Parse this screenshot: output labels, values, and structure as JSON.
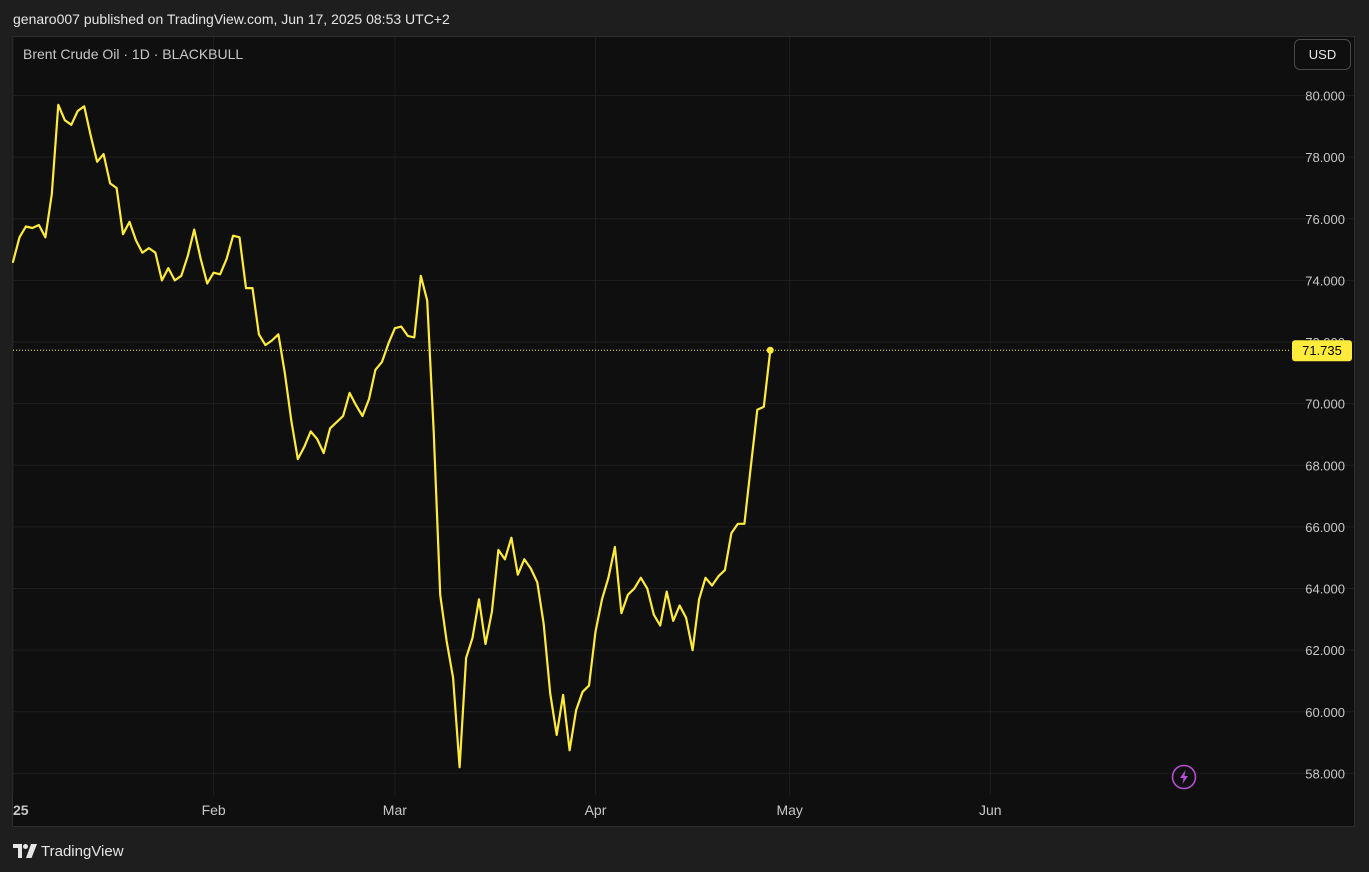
{
  "header": {
    "published_text": "genaro007 published on TradingView.com, Jun 17, 2025 08:53 UTC+2"
  },
  "chart_header": {
    "symbol_label": "Brent Crude Oil · 1D · BLACKBULL",
    "currency_label": "USD"
  },
  "footer": {
    "brand_text": "TradingView",
    "brand_icon": "tradingview-logo-icon"
  },
  "icons": {
    "bolt": "lightning-bolt-icon"
  },
  "colors": {
    "line": "#ffeb3b",
    "background": "#0f0f0f",
    "grid": "#1f1f1f",
    "text": "#c8c8c8",
    "price_badge_bg": "#ffeb3b",
    "price_badge_text": "#000000",
    "bolt": "#b44fd6"
  },
  "chart_data": {
    "type": "line",
    "title": "",
    "xlabel": "",
    "ylabel": "",
    "ylim": [
      57.3,
      81.9
    ],
    "xlim": [
      "2025-01-01",
      "2025-06-30"
    ],
    "y_ticks": [
      "58.000",
      "60.000",
      "62.000",
      "64.000",
      "66.000",
      "68.000",
      "70.000",
      "72.000",
      "74.000",
      "76.000",
      "78.000",
      "80.000"
    ],
    "x_ticks": [
      {
        "label": "25",
        "date": "2025-01-01"
      },
      {
        "label": "Feb",
        "date": "2025-02-01"
      },
      {
        "label": "Mar",
        "date": "2025-03-01"
      },
      {
        "label": "Apr",
        "date": "2025-04-01"
      },
      {
        "label": "May",
        "date": "2025-05-01"
      },
      {
        "label": "Jun",
        "date": "2025-06-01"
      }
    ],
    "last_price_label": "71.735",
    "last_price": 71.735,
    "grid": true,
    "series": [
      {
        "values": [
          [
            "2025-01-01",
            74.6
          ],
          [
            "2025-01-02",
            75.4
          ],
          [
            "2025-01-03",
            75.75
          ],
          [
            "2025-01-04",
            75.7
          ],
          [
            "2025-01-05",
            75.8
          ],
          [
            "2025-01-06",
            75.4
          ],
          [
            "2025-01-07",
            76.8
          ],
          [
            "2025-01-08",
            79.7
          ],
          [
            "2025-01-09",
            79.2
          ],
          [
            "2025-01-10",
            79.05
          ],
          [
            "2025-01-11",
            79.5
          ],
          [
            "2025-01-12",
            79.65
          ],
          [
            "2025-01-13",
            78.7
          ],
          [
            "2025-01-14",
            77.85
          ],
          [
            "2025-01-15",
            78.1
          ],
          [
            "2025-01-16",
            77.15
          ],
          [
            "2025-01-17",
            77.0
          ],
          [
            "2025-01-18",
            75.5
          ],
          [
            "2025-01-19",
            75.9
          ],
          [
            "2025-01-20",
            75.3
          ],
          [
            "2025-01-21",
            74.9
          ],
          [
            "2025-01-22",
            75.05
          ],
          [
            "2025-01-23",
            74.9
          ],
          [
            "2025-01-24",
            74.0
          ],
          [
            "2025-01-25",
            74.4
          ],
          [
            "2025-01-26",
            74.0
          ],
          [
            "2025-01-27",
            74.15
          ],
          [
            "2025-01-28",
            74.8
          ],
          [
            "2025-01-29",
            75.65
          ],
          [
            "2025-01-30",
            74.7
          ],
          [
            "2025-01-31",
            73.9
          ],
          [
            "2025-02-01",
            74.25
          ],
          [
            "2025-02-02",
            74.2
          ],
          [
            "2025-02-03",
            74.7
          ],
          [
            "2025-02-04",
            75.45
          ],
          [
            "2025-02-05",
            75.4
          ],
          [
            "2025-02-06",
            73.75
          ],
          [
            "2025-02-07",
            73.75
          ],
          [
            "2025-02-08",
            72.25
          ],
          [
            "2025-02-09",
            71.9
          ],
          [
            "2025-02-10",
            72.05
          ],
          [
            "2025-02-11",
            72.25
          ],
          [
            "2025-02-12",
            71.0
          ],
          [
            "2025-02-13",
            69.45
          ],
          [
            "2025-02-14",
            68.2
          ],
          [
            "2025-02-15",
            68.6
          ],
          [
            "2025-02-16",
            69.1
          ],
          [
            "2025-02-17",
            68.85
          ],
          [
            "2025-02-18",
            68.4
          ],
          [
            "2025-02-19",
            69.2
          ],
          [
            "2025-02-20",
            69.4
          ],
          [
            "2025-02-21",
            69.6
          ],
          [
            "2025-02-22",
            70.35
          ],
          [
            "2025-02-23",
            69.95
          ],
          [
            "2025-02-24",
            69.6
          ],
          [
            "2025-02-25",
            70.15
          ],
          [
            "2025-02-26",
            71.1
          ],
          [
            "2025-02-27",
            71.35
          ],
          [
            "2025-02-28",
            71.95
          ],
          [
            "2025-03-01",
            72.45
          ],
          [
            "2025-03-02",
            72.5
          ],
          [
            "2025-03-03",
            72.2
          ],
          [
            "2025-03-04",
            72.15
          ],
          [
            "2025-03-05",
            74.15
          ],
          [
            "2025-03-06",
            73.35
          ],
          [
            "2025-03-07",
            69.1
          ],
          [
            "2025-03-08",
            63.8
          ],
          [
            "2025-03-09",
            62.3
          ],
          [
            "2025-03-10",
            61.1
          ],
          [
            "2025-03-11",
            58.2
          ],
          [
            "2025-03-12",
            61.75
          ],
          [
            "2025-03-13",
            62.4
          ],
          [
            "2025-03-14",
            63.65
          ],
          [
            "2025-03-15",
            62.2
          ],
          [
            "2025-03-16",
            63.25
          ],
          [
            "2025-03-17",
            65.25
          ],
          [
            "2025-03-18",
            64.95
          ],
          [
            "2025-03-19",
            65.65
          ],
          [
            "2025-03-20",
            64.45
          ],
          [
            "2025-03-21",
            64.95
          ],
          [
            "2025-03-22",
            64.65
          ],
          [
            "2025-03-23",
            64.2
          ],
          [
            "2025-03-24",
            62.85
          ],
          [
            "2025-03-25",
            60.6
          ],
          [
            "2025-03-26",
            59.25
          ],
          [
            "2025-03-27",
            60.55
          ],
          [
            "2025-03-28",
            58.75
          ],
          [
            "2025-03-29",
            60.05
          ],
          [
            "2025-03-30",
            60.65
          ],
          [
            "2025-03-31",
            60.85
          ],
          [
            "2025-04-01",
            62.6
          ],
          [
            "2025-04-02",
            63.65
          ],
          [
            "2025-04-03",
            64.35
          ],
          [
            "2025-04-04",
            65.35
          ],
          [
            "2025-04-05",
            63.2
          ],
          [
            "2025-04-06",
            63.8
          ],
          [
            "2025-04-07",
            64.0
          ],
          [
            "2025-04-08",
            64.35
          ],
          [
            "2025-04-09",
            64.0
          ],
          [
            "2025-04-10",
            63.15
          ],
          [
            "2025-04-11",
            62.8
          ],
          [
            "2025-04-12",
            63.9
          ],
          [
            "2025-04-13",
            62.95
          ],
          [
            "2025-04-14",
            63.45
          ],
          [
            "2025-04-15",
            63.05
          ],
          [
            "2025-04-16",
            62.0
          ],
          [
            "2025-04-17",
            63.65
          ],
          [
            "2025-04-18",
            64.35
          ],
          [
            "2025-04-19",
            64.1
          ],
          [
            "2025-04-20",
            64.4
          ],
          [
            "2025-04-21",
            64.6
          ],
          [
            "2025-04-22",
            65.8
          ],
          [
            "2025-04-23",
            66.1
          ],
          [
            "2025-04-24",
            66.1
          ],
          [
            "2025-04-25",
            67.95
          ],
          [
            "2025-04-26",
            69.8
          ],
          [
            "2025-04-27",
            69.9
          ],
          [
            "2025-04-28",
            71.735
          ]
        ]
      }
    ]
  }
}
